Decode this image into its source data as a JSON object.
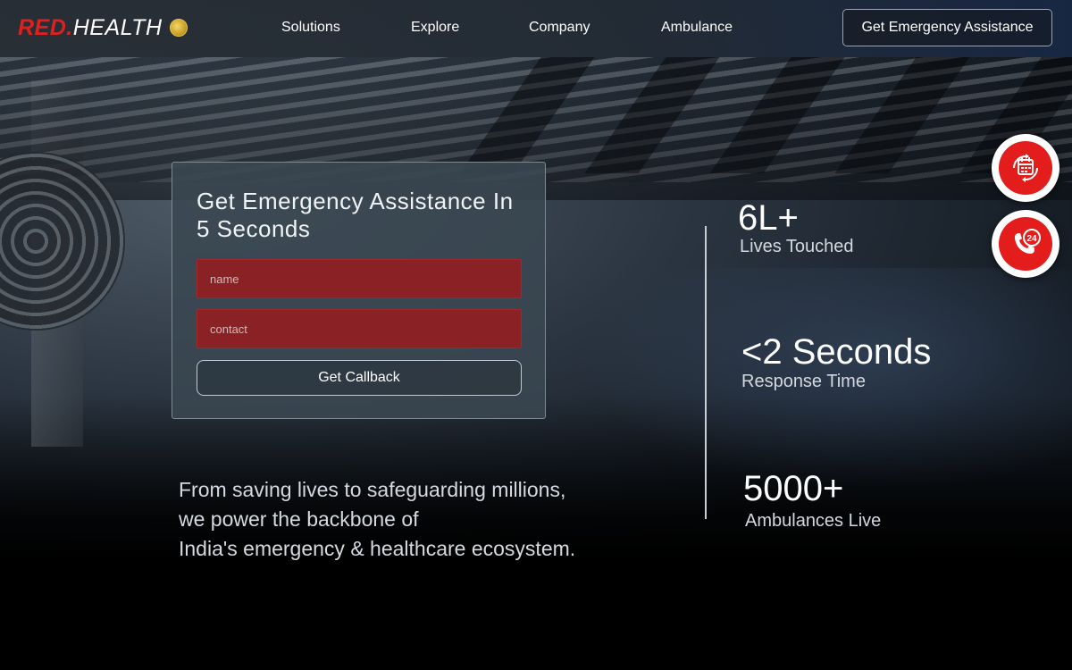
{
  "brand": {
    "part1": "RED.",
    "part2": "HEALTH"
  },
  "nav": {
    "items": [
      {
        "label": "Solutions"
      },
      {
        "label": "Explore"
      },
      {
        "label": "Company"
      },
      {
        "label": "Ambulance"
      }
    ],
    "cta_label": "Get Emergency Assistance"
  },
  "form": {
    "title": "Get Emergency Assistance In 5 Seconds",
    "name_placeholder": "name",
    "contact_placeholder": "contact",
    "button_label": "Get Callback"
  },
  "tagline": {
    "lines": [
      "From saving lives to safeguarding millions,",
      "we power the backbone of",
      "India's emergency & healthcare ecosystem."
    ]
  },
  "stats": [
    {
      "value": "6L+",
      "label": "Lives Touched"
    },
    {
      "value": "<2 Seconds",
      "label": "Response Time"
    },
    {
      "value": "5000+",
      "label": "Ambulances Live"
    }
  ],
  "floating_buttons": [
    {
      "icon": "calendar-refresh-icon"
    },
    {
      "icon": "phone-24-icon"
    }
  ],
  "colors": {
    "brand_red": "#e0201f",
    "field_red": "#8a2124",
    "fab_red": "#e31c1c"
  }
}
